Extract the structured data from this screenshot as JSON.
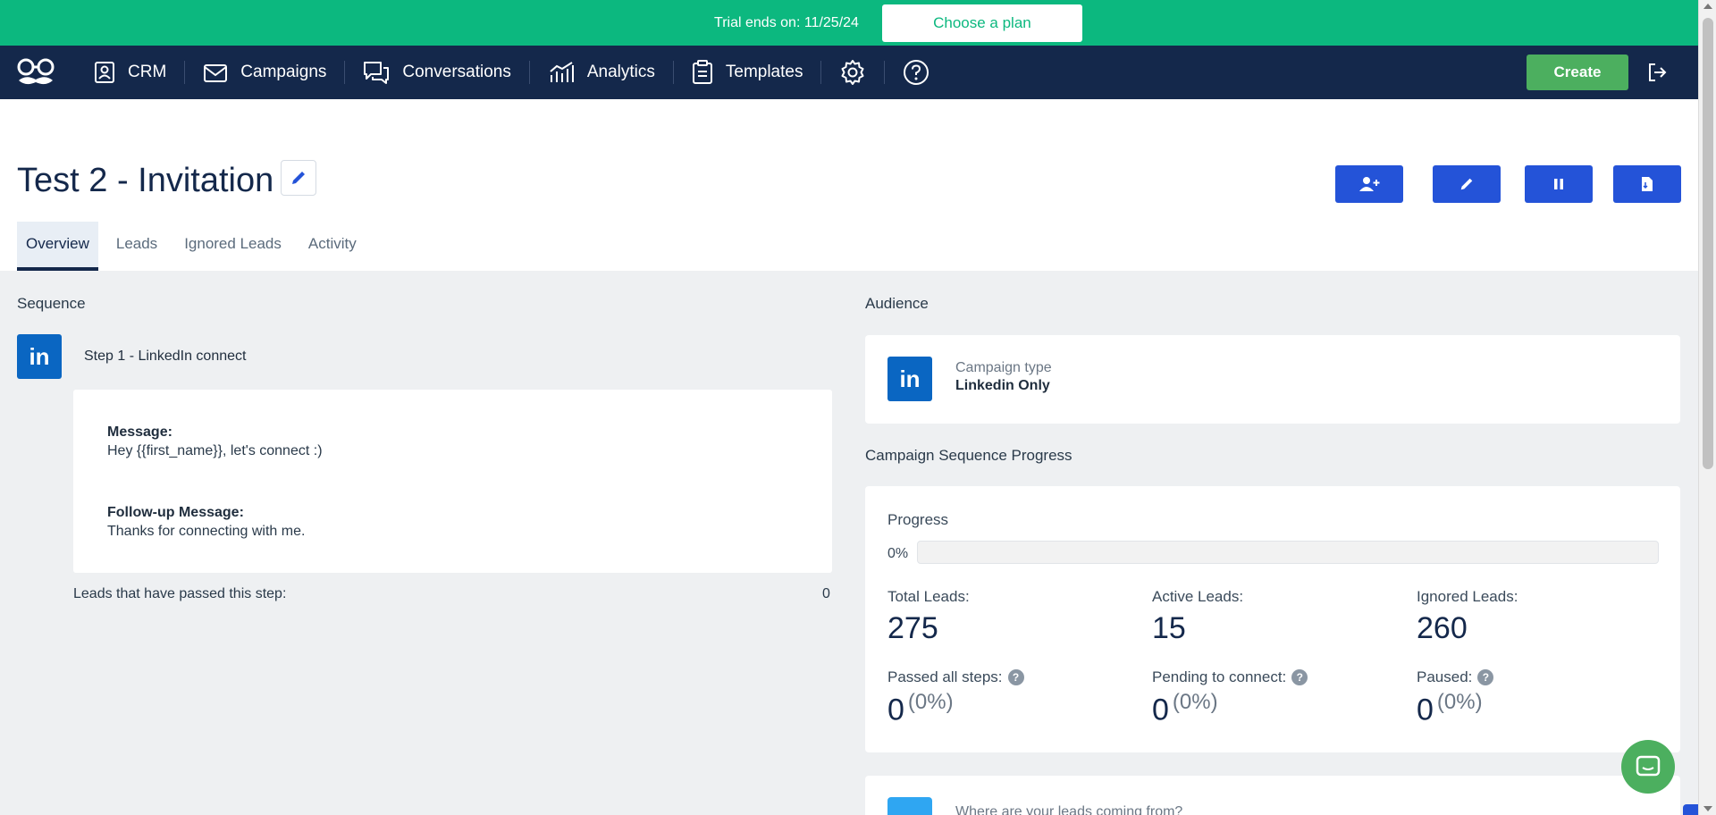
{
  "trial": {
    "text": "Trial ends on: 11/25/24",
    "button": "Choose a plan"
  },
  "nav": {
    "items": [
      {
        "label": "CRM",
        "icon": "crm-icon"
      },
      {
        "label": "Campaigns",
        "icon": "campaigns-icon"
      },
      {
        "label": "Conversations",
        "icon": "conversations-icon"
      },
      {
        "label": "Analytics",
        "icon": "analytics-icon"
      },
      {
        "label": "Templates",
        "icon": "templates-icon"
      }
    ],
    "create": "Create"
  },
  "page": {
    "title": "Test 2 - Invitation"
  },
  "tabs": [
    "Overview",
    "Leads",
    "Ignored Leads",
    "Activity"
  ],
  "sequence": {
    "heading": "Sequence",
    "step_title": "Step 1 - LinkedIn connect",
    "message_label": "Message:",
    "message_text": "Hey {{first_name}}, let's connect :)",
    "followup_label": "Follow-up Message:",
    "followup_text": "Thanks for connecting with me.",
    "passed_label": "Leads that have passed this step:",
    "passed_value": "0"
  },
  "audience": {
    "heading": "Audience",
    "campaign_type_label": "Campaign type",
    "campaign_type_value": "Linkedin Only"
  },
  "progress": {
    "heading": "Campaign Sequence Progress",
    "label": "Progress",
    "percent_text": "0%",
    "fraction": 0,
    "total_label": "Total Leads:",
    "total_value": "275",
    "active_label": "Active Leads:",
    "active_value": "15",
    "ignored_label": "Ignored Leads:",
    "ignored_value": "260",
    "passed_label": "Passed all steps:",
    "passed_value": "0",
    "passed_pct": "(0%)",
    "pending_label": "Pending to connect:",
    "pending_value": "0",
    "pending_pct": "(0%)",
    "paused_label": "Paused:",
    "paused_value": "0",
    "paused_pct": "(0%)"
  },
  "sources": {
    "question": "Where are your leads coming from?"
  },
  "linkedin_badge": "in",
  "colors": {
    "trial_green": "#0cb87f",
    "nav_navy": "#14284b",
    "create_green": "#4caf5f",
    "action_blue": "#2453d8",
    "linkedin_blue": "#0a66c2"
  }
}
